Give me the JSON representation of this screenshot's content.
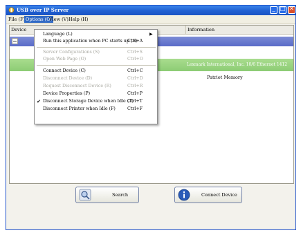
{
  "window": {
    "title": "USB over IP Server",
    "controls": {
      "minimize": "_",
      "maximize": "□",
      "close": "✕"
    }
  },
  "menubar": {
    "file": "File (F)",
    "options": "Options (O)",
    "view": "View (V)",
    "help": "Help (H)"
  },
  "list": {
    "columns": [
      "Device",
      "Information"
    ],
    "rows": [
      {
        "information": ""
      },
      {
        "information": "Lexmark International, Inc. 10/6 Ethernet 1412"
      },
      {
        "information": "Patriot Memory"
      }
    ]
  },
  "options_menu": {
    "items": [
      {
        "label": "Language (L)",
        "shortcut": "",
        "submenu": true,
        "disabled": false,
        "checked": false
      },
      {
        "label": "Run this application when PC starts up (A)",
        "shortcut": "Ctrl+A",
        "submenu": false,
        "disabled": false,
        "checked": false
      },
      {
        "label": "Server Configurations (S)",
        "shortcut": "Ctrl+S",
        "submenu": false,
        "disabled": true,
        "checked": false
      },
      {
        "label": "Open Web Page (O)",
        "shortcut": "Ctrl+O",
        "submenu": false,
        "disabled": true,
        "checked": false
      },
      {
        "label": "Connect Device (C)",
        "shortcut": "Ctrl+C",
        "submenu": false,
        "disabled": false,
        "checked": false
      },
      {
        "label": "Disconnect Device (D)",
        "shortcut": "Ctrl+D",
        "submenu": false,
        "disabled": true,
        "checked": false
      },
      {
        "label": "Request Disconnect Device (R)",
        "shortcut": "Ctrl+R",
        "submenu": false,
        "disabled": true,
        "checked": false
      },
      {
        "label": "Device Properties (P)",
        "shortcut": "Ctrl+P",
        "submenu": false,
        "disabled": false,
        "checked": false
      },
      {
        "label": "Disconnect Storage Device when Idle (T)",
        "shortcut": "Ctrl+T",
        "submenu": false,
        "disabled": false,
        "checked": true
      },
      {
        "label": "Disconnect Printer when Idle (F)",
        "shortcut": "Ctrl+F",
        "submenu": false,
        "disabled": false,
        "checked": false
      }
    ]
  },
  "buttons": {
    "search": "Search",
    "connect": "Connect Device"
  },
  "colors": {
    "titlebar": "#1f5fd1",
    "menu_highlight": "#316ac5",
    "row_blue": "#6a7bd0",
    "row_green": "#98d27f"
  }
}
